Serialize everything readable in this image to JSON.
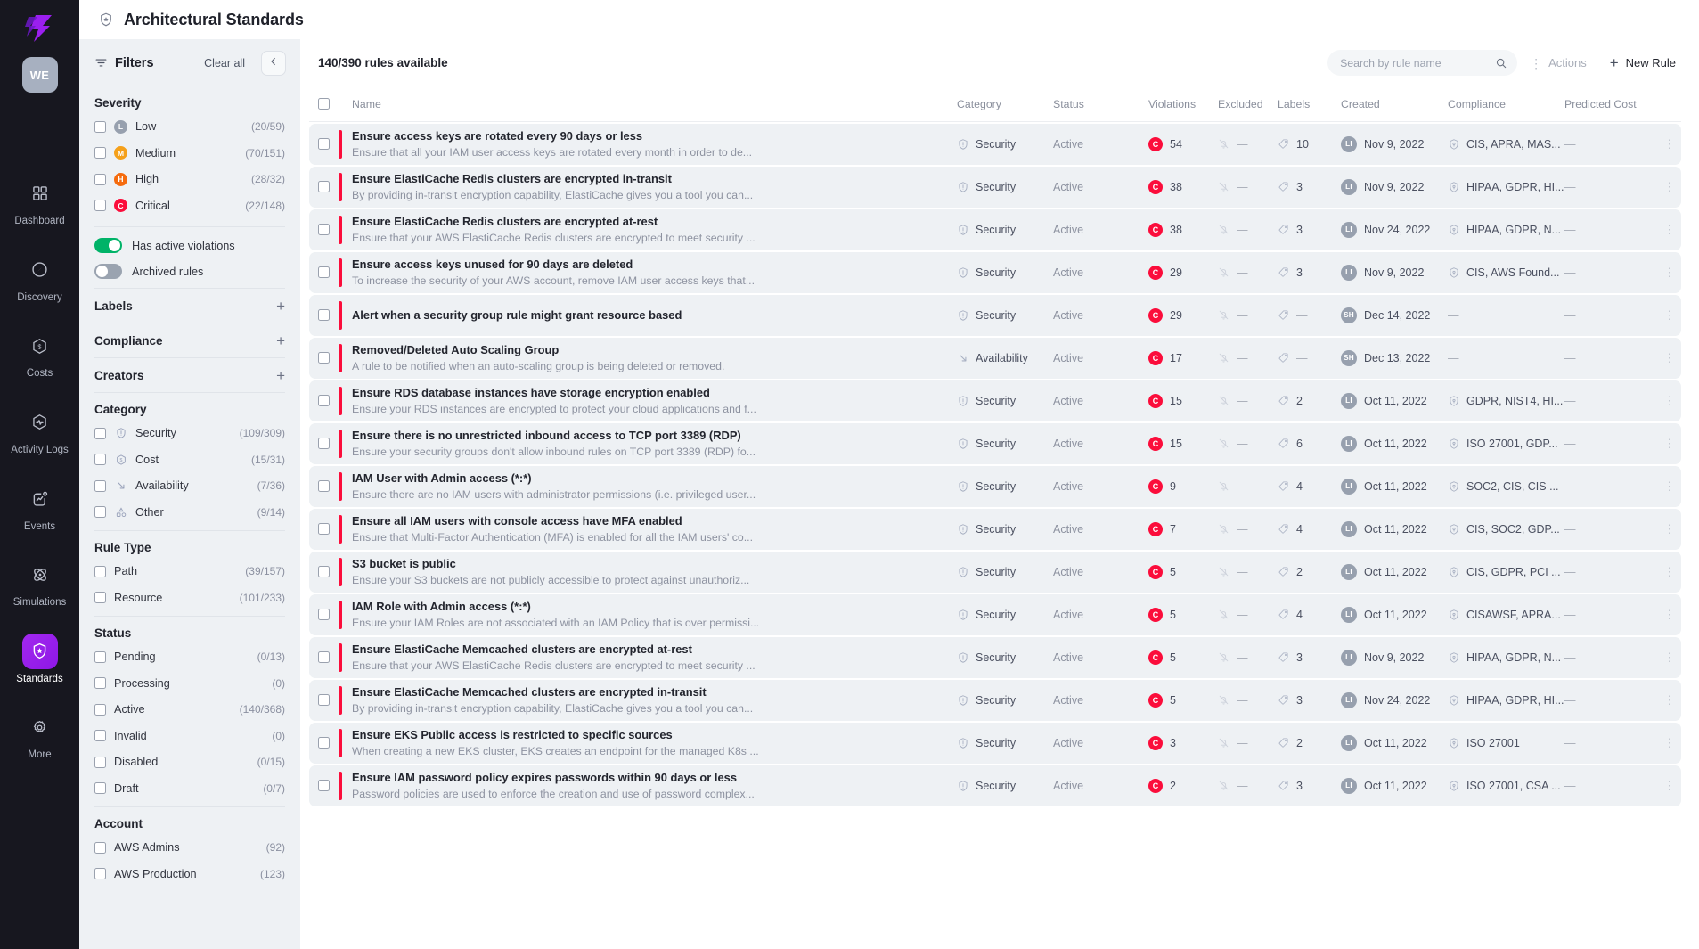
{
  "app": {
    "logo_icon": "lightning-bolt-logo",
    "user_initials": "WE"
  },
  "sidebar": {
    "items": [
      {
        "label": "Dashboard",
        "icon": "grid-icon",
        "active": false
      },
      {
        "label": "Discovery",
        "icon": "compass-icon",
        "active": false
      },
      {
        "label": "Costs",
        "icon": "dollar-hex-icon",
        "active": false
      },
      {
        "label": "Activity Logs",
        "icon": "pulse-hex-icon",
        "active": false
      },
      {
        "label": "Events",
        "icon": "chart-alert-icon",
        "active": false
      },
      {
        "label": "Simulations",
        "icon": "atom-icon",
        "active": false
      },
      {
        "label": "Standards",
        "icon": "shield-star-icon",
        "active": true
      },
      {
        "label": "More",
        "icon": "gear-icon",
        "active": false
      }
    ]
  },
  "header": {
    "title": "Architectural Standards",
    "icon": "shield-star-icon"
  },
  "filters": {
    "title": "Filters",
    "icon": "filter-icon",
    "clear_all": "Clear all",
    "collapse_icon": "chevron-left-icon",
    "severity": {
      "title": "Severity",
      "items": [
        {
          "label": "Low",
          "badge": "L",
          "color": "#97a0ae",
          "count": "(20/59)"
        },
        {
          "label": "Medium",
          "badge": "M",
          "color": "#f5a01a",
          "count": "(70/151)"
        },
        {
          "label": "High",
          "badge": "H",
          "color": "#f56b0e",
          "count": "(28/32)"
        },
        {
          "label": "Critical",
          "badge": "C",
          "color": "#fb0d3b",
          "count": "(22/148)"
        }
      ]
    },
    "toggles": [
      {
        "label": "Has active violations",
        "on": true
      },
      {
        "label": "Archived rules",
        "on": false
      }
    ],
    "labels": {
      "title": "Labels",
      "add_icon": "plus-icon"
    },
    "compliance": {
      "title": "Compliance",
      "add_icon": "plus-icon"
    },
    "creators": {
      "title": "Creators",
      "add_icon": "plus-icon"
    },
    "category": {
      "title": "Category",
      "items": [
        {
          "label": "Security",
          "icon": "shield-alert-icon",
          "count": "(109/309)"
        },
        {
          "label": "Cost",
          "icon": "dollar-hex-icon",
          "count": "(15/31)"
        },
        {
          "label": "Availability",
          "icon": "arrow-down-right-icon",
          "count": "(7/36)"
        },
        {
          "label": "Other",
          "icon": "shapes-icon",
          "count": "(9/14)"
        }
      ]
    },
    "rule_type": {
      "title": "Rule Type",
      "items": [
        {
          "label": "Path",
          "count": "(39/157)"
        },
        {
          "label": "Resource",
          "count": "(101/233)"
        }
      ]
    },
    "status": {
      "title": "Status",
      "items": [
        {
          "label": "Pending",
          "count": "(0/13)"
        },
        {
          "label": "Processing",
          "count": "(0)"
        },
        {
          "label": "Active",
          "count": "(140/368)"
        },
        {
          "label": "Invalid",
          "count": "(0)"
        },
        {
          "label": "Disabled",
          "count": "(0/15)"
        },
        {
          "label": "Draft",
          "count": "(0/7)"
        }
      ]
    },
    "account": {
      "title": "Account",
      "items": [
        {
          "label": "AWS Admins",
          "count": "(92)"
        },
        {
          "label": "AWS Production",
          "count": "(123)"
        }
      ]
    }
  },
  "toolbar": {
    "rules_available": "140/390 rules available",
    "search_placeholder": "Search by rule name",
    "search_value": "",
    "search_icon": "search-icon",
    "actions_label": "Actions",
    "actions_icon": "vertical-dots-icon",
    "new_rule_label": "New Rule",
    "new_rule_icon": "plus-icon"
  },
  "table": {
    "columns": [
      "Name",
      "Category",
      "Status",
      "Violations",
      "Excluded",
      "Labels",
      "Created",
      "Compliance",
      "Predicted Cost"
    ],
    "rows": [
      {
        "name": "Ensure access keys are rotated every 90 days or less",
        "desc": "Ensure that all your IAM user access keys are rotated every month in order to de...",
        "category": "Security",
        "cat_icon": "shield-alert-icon",
        "status": "Active",
        "violations": "54",
        "violation_badge": "C",
        "excluded": "—",
        "labels": "10",
        "created": "Nov 9, 2022",
        "creator": "LI",
        "compliance": "CIS, APRA, MAS...",
        "cost": "—"
      },
      {
        "name": "Ensure ElastiCache Redis clusters are encrypted in-transit",
        "desc": "By providing in-transit encryption capability, ElastiCache gives you a tool you can...",
        "category": "Security",
        "cat_icon": "shield-alert-icon",
        "status": "Active",
        "violations": "38",
        "violation_badge": "C",
        "excluded": "—",
        "labels": "3",
        "created": "Nov 9, 2022",
        "creator": "LI",
        "compliance": "HIPAA, GDPR, HI...",
        "cost": "—"
      },
      {
        "name": "Ensure ElastiCache Redis clusters are encrypted at-rest",
        "desc": "Ensure that your AWS ElastiCache Redis clusters are encrypted to meet security ...",
        "category": "Security",
        "cat_icon": "shield-alert-icon",
        "status": "Active",
        "violations": "38",
        "violation_badge": "C",
        "excluded": "—",
        "labels": "3",
        "created": "Nov 24, 2022",
        "creator": "LI",
        "compliance": "HIPAA, GDPR, N...",
        "cost": "—"
      },
      {
        "name": "Ensure access keys unused for 90 days are deleted",
        "desc": "To increase the security of your AWS account, remove IAM user access keys that...",
        "category": "Security",
        "cat_icon": "shield-alert-icon",
        "status": "Active",
        "violations": "29",
        "violation_badge": "C",
        "excluded": "—",
        "labels": "3",
        "created": "Nov 9, 2022",
        "creator": "LI",
        "compliance": "CIS, AWS Found...",
        "cost": "—"
      },
      {
        "name": "Alert when a security group rule might grant resource based",
        "desc": "",
        "category": "Security",
        "cat_icon": "shield-alert-icon",
        "status": "Active",
        "violations": "29",
        "violation_badge": "C",
        "excluded": "—",
        "labels": "—",
        "created": "Dec 14, 2022",
        "creator": "SH",
        "compliance": "—",
        "cost": "—"
      },
      {
        "name": "Removed/Deleted Auto Scaling Group",
        "desc": "A rule to be notified when an auto-scaling group is being deleted or removed.",
        "category": "Availability",
        "cat_icon": "arrow-down-right-icon",
        "status": "Active",
        "violations": "17",
        "violation_badge": "C",
        "excluded": "—",
        "labels": "—",
        "created": "Dec 13, 2022",
        "creator": "SH",
        "compliance": "—",
        "cost": "—"
      },
      {
        "name": "Ensure RDS database instances have storage encryption enabled",
        "desc": "Ensure your RDS instances are encrypted to protect your cloud applications and f...",
        "category": "Security",
        "cat_icon": "shield-alert-icon",
        "status": "Active",
        "violations": "15",
        "violation_badge": "C",
        "excluded": "—",
        "labels": "2",
        "created": "Oct 11, 2022",
        "creator": "LI",
        "compliance": "GDPR, NIST4, HI...",
        "cost": "—"
      },
      {
        "name": "Ensure there is no unrestricted inbound access to TCP port 3389 (RDP)",
        "desc": "Ensure your security groups don't allow inbound rules on TCP port 3389 (RDP) fo...",
        "category": "Security",
        "cat_icon": "shield-alert-icon",
        "status": "Active",
        "violations": "15",
        "violation_badge": "C",
        "excluded": "—",
        "labels": "6",
        "created": "Oct 11, 2022",
        "creator": "LI",
        "compliance": "ISO 27001, GDP...",
        "cost": "—"
      },
      {
        "name": "IAM User with Admin access (*:*)",
        "desc": "Ensure there are no IAM users with administrator permissions (i.e. privileged user...",
        "category": "Security",
        "cat_icon": "shield-alert-icon",
        "status": "Active",
        "violations": "9",
        "violation_badge": "C",
        "excluded": "—",
        "labels": "4",
        "created": "Oct 11, 2022",
        "creator": "LI",
        "compliance": "SOC2, CIS, CIS ...",
        "cost": "—"
      },
      {
        "name": "Ensure all IAM users with console access have MFA enabled",
        "desc": "Ensure that Multi-Factor Authentication (MFA) is enabled for all the IAM users' co...",
        "category": "Security",
        "cat_icon": "shield-alert-icon",
        "status": "Active",
        "violations": "7",
        "violation_badge": "C",
        "excluded": "—",
        "labels": "4",
        "created": "Oct 11, 2022",
        "creator": "LI",
        "compliance": "CIS, SOC2, GDP...",
        "cost": "—"
      },
      {
        "name": "S3 bucket is public",
        "desc": "Ensure your S3 buckets are not publicly accessible to protect against unauthoriz...",
        "category": "Security",
        "cat_icon": "shield-alert-icon",
        "status": "Active",
        "violations": "5",
        "violation_badge": "C",
        "excluded": "—",
        "labels": "2",
        "created": "Oct 11, 2022",
        "creator": "LI",
        "compliance": "CIS, GDPR, PCI ...",
        "cost": "—"
      },
      {
        "name": "IAM Role with Admin access (*:*)",
        "desc": "Ensure your IAM Roles are not associated with an IAM Policy that is over permissi...",
        "category": "Security",
        "cat_icon": "shield-alert-icon",
        "status": "Active",
        "violations": "5",
        "violation_badge": "C",
        "excluded": "—",
        "labels": "4",
        "created": "Oct 11, 2022",
        "creator": "LI",
        "compliance": "CISAWSF, APRA...",
        "cost": "—"
      },
      {
        "name": "Ensure ElastiCache Memcached clusters are encrypted at-rest",
        "desc": "Ensure that your AWS ElastiCache Redis clusters are encrypted to meet security ...",
        "category": "Security",
        "cat_icon": "shield-alert-icon",
        "status": "Active",
        "violations": "5",
        "violation_badge": "C",
        "excluded": "—",
        "labels": "3",
        "created": "Nov 9, 2022",
        "creator": "LI",
        "compliance": "HIPAA, GDPR, N...",
        "cost": "—"
      },
      {
        "name": "Ensure ElastiCache Memcached clusters are encrypted in-transit",
        "desc": "By providing in-transit encryption capability, ElastiCache gives you a tool you can...",
        "category": "Security",
        "cat_icon": "shield-alert-icon",
        "status": "Active",
        "violations": "5",
        "violation_badge": "C",
        "excluded": "—",
        "labels": "3",
        "created": "Nov 24, 2022",
        "creator": "LI",
        "compliance": "HIPAA, GDPR, HI...",
        "cost": "—"
      },
      {
        "name": "Ensure EKS Public access is restricted to specific sources",
        "desc": "When creating a new EKS cluster, EKS creates an endpoint for the managed K8s ...",
        "category": "Security",
        "cat_icon": "shield-alert-icon",
        "status": "Active",
        "violations": "3",
        "violation_badge": "C",
        "excluded": "—",
        "labels": "2",
        "created": "Oct 11, 2022",
        "creator": "LI",
        "compliance": "ISO 27001",
        "cost": "—"
      },
      {
        "name": "Ensure IAM password policy expires passwords within 90 days or less",
        "desc": "Password policies are used to enforce the creation and use of password complex...",
        "category": "Security",
        "cat_icon": "shield-alert-icon",
        "status": "Active",
        "violations": "2",
        "violation_badge": "C",
        "excluded": "—",
        "labels": "3",
        "created": "Oct 11, 2022",
        "creator": "LI",
        "compliance": "ISO 27001, CSA ...",
        "cost": "—"
      }
    ]
  },
  "colors": {
    "critical": "#fb0d3b",
    "high": "#f56b0e",
    "medium": "#f5a01a",
    "low": "#97a0ae",
    "accent": "#a228ef",
    "toggle_on": "#00b368"
  }
}
